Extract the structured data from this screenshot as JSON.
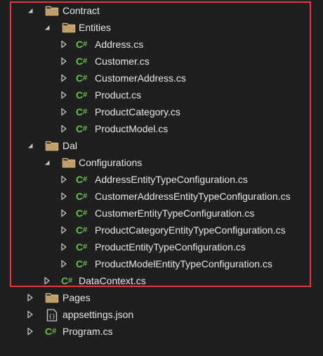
{
  "tree": [
    {
      "depth": 0,
      "label": "Contract",
      "type": "folder",
      "expanded": true
    },
    {
      "depth": 1,
      "label": "Entities",
      "type": "folder",
      "expanded": true
    },
    {
      "depth": 2,
      "label": "Address.cs",
      "type": "csharp",
      "expanded": false
    },
    {
      "depth": 2,
      "label": "Customer.cs",
      "type": "csharp",
      "expanded": false
    },
    {
      "depth": 2,
      "label": "CustomerAddress.cs",
      "type": "csharp",
      "expanded": false
    },
    {
      "depth": 2,
      "label": "Product.cs",
      "type": "csharp",
      "expanded": false
    },
    {
      "depth": 2,
      "label": "ProductCategory.cs",
      "type": "csharp",
      "expanded": false
    },
    {
      "depth": 2,
      "label": "ProductModel.cs",
      "type": "csharp",
      "expanded": false
    },
    {
      "depth": 0,
      "label": "Dal",
      "type": "folder",
      "expanded": true
    },
    {
      "depth": 1,
      "label": "Configurations",
      "type": "folder",
      "expanded": true
    },
    {
      "depth": 2,
      "label": "AddressEntityTypeConfiguration.cs",
      "type": "csharp",
      "expanded": false
    },
    {
      "depth": 2,
      "label": "CustomerAddressEntityTypeConfiguration.cs",
      "type": "csharp",
      "expanded": false
    },
    {
      "depth": 2,
      "label": "CustomerEntityTypeConfiguration.cs",
      "type": "csharp",
      "expanded": false
    },
    {
      "depth": 2,
      "label": "ProductCategoryEntityTypeConfiguration.cs",
      "type": "csharp",
      "expanded": false
    },
    {
      "depth": 2,
      "label": "ProductEntityTypeConfiguration.cs",
      "type": "csharp",
      "expanded": false
    },
    {
      "depth": 2,
      "label": "ProductModelEntityTypeConfiguration.cs",
      "type": "csharp",
      "expanded": false
    },
    {
      "depth": 1,
      "label": "DataContext.cs",
      "type": "csharp",
      "expanded": false
    },
    {
      "depth": 0,
      "label": "Pages",
      "type": "folder",
      "expanded": false
    },
    {
      "depth": 0,
      "label": "appsettings.json",
      "type": "json",
      "expanded": false
    },
    {
      "depth": 0,
      "label": "Program.cs",
      "type": "csharp",
      "expanded": false
    }
  ],
  "colors": {
    "background": "#1f1f1f",
    "folder": "#dcb67a",
    "csharp": "#68c04a",
    "highlight": "#e0393e",
    "text": "#e8e8e8",
    "arrow": "#c8c8c8"
  }
}
